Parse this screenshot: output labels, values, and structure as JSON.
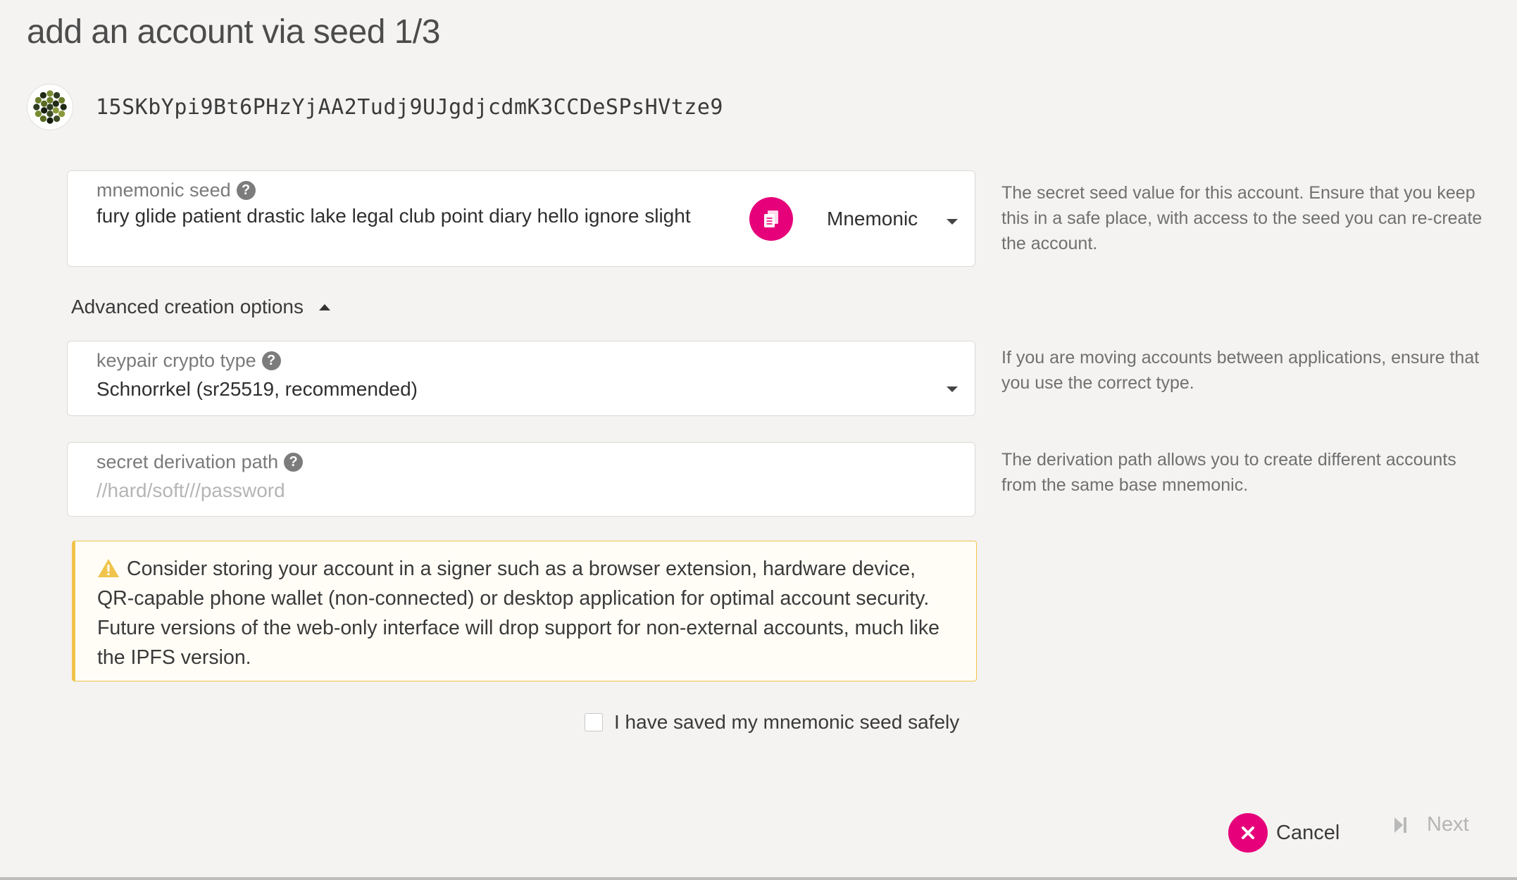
{
  "page": {
    "title": "add an account via seed 1/3"
  },
  "account": {
    "address": "15SKbYpi9Bt6PHzYjAA2Tudj9UJgdjcdmK3CCDeSPsHVtze9"
  },
  "seed_field": {
    "label": "mnemonic seed",
    "value": "fury glide patient drastic lake legal club point diary hello ignore slight",
    "type_selected": "Mnemonic",
    "help": "The secret seed value for this account. Ensure that you keep this in a safe place, with access to the seed you can re-create the account."
  },
  "advanced": {
    "label": "Advanced creation options"
  },
  "crypto_field": {
    "label": "keypair crypto type",
    "value": "Schnorrkel (sr25519, recommended)",
    "help": "If you are moving accounts between applications, ensure that you use the correct type."
  },
  "derivation_field": {
    "label": "secret derivation path",
    "placeholder": "//hard/soft///password",
    "help": "The derivation path allows you to create different accounts from the same base mnemonic."
  },
  "warning": {
    "text": "Consider storing your account in a signer such as a browser extension, hardware device, QR-capable phone wallet (non-connected) or desktop application for optimal account security. Future versions of the web-only interface will drop support for non-external accounts, much like the IPFS version."
  },
  "confirm": {
    "label": "I have saved my mnemonic seed safely",
    "checked": false
  },
  "footer": {
    "cancel_label": "Cancel",
    "next_label": "Next"
  },
  "colors": {
    "accent": "#e6007a",
    "warning": "#f0c44b",
    "background": "#f4f3f2"
  },
  "icons": {
    "identicon": "polkadot-identicon",
    "help": "question-circle-icon",
    "copy": "copy-icon",
    "warning": "warning-triangle-icon",
    "cancel": "times-icon",
    "next": "step-forward-icon"
  }
}
